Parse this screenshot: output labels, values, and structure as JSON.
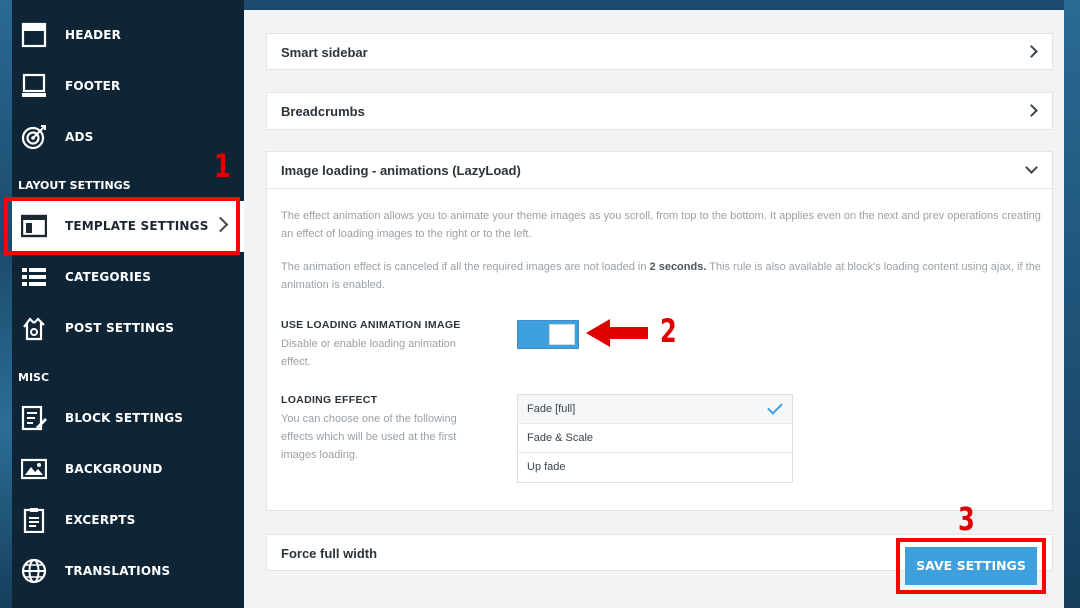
{
  "sidebar": {
    "items_top": [
      {
        "label": "HEADER",
        "icon": "header-icon"
      },
      {
        "label": "FOOTER",
        "icon": "footer-icon"
      },
      {
        "label": "ADS",
        "icon": "target-icon"
      }
    ],
    "layout_section": "LAYOUT SETTINGS",
    "items_layout": [
      {
        "label": "TEMPLATE SETTINGS",
        "icon": "template-icon",
        "active": true
      },
      {
        "label": "CATEGORIES",
        "icon": "list-icon"
      },
      {
        "label": "POST SETTINGS",
        "icon": "post-settings-icon"
      }
    ],
    "misc_section": "MISC",
    "items_misc": [
      {
        "label": "BLOCK SETTINGS",
        "icon": "block-settings-icon"
      },
      {
        "label": "BACKGROUND",
        "icon": "image-icon"
      },
      {
        "label": "EXCERPTS",
        "icon": "document-icon"
      },
      {
        "label": "TRANSLATIONS",
        "icon": "globe-icon"
      }
    ]
  },
  "panels": {
    "smart_sidebar": "Smart sidebar",
    "breadcrumbs": "Breadcrumbs",
    "image_loading": "Image loading - animations (LazyLoad)",
    "force_full_width": "Force full width"
  },
  "image_loading": {
    "desc1": "The effect animation allows you to animate your theme images as you scroll, from top to the bottom. It applies even on the next and prev operations creating an effect of loading images to the right or to the left.",
    "desc2_before": "The animation effect is canceled if all the required images are not loaded in ",
    "desc2_bold": "2 seconds.",
    "desc2_after": " This rule is also available at block's loading content using ajax, if the animation is enabled.",
    "toggle_title": "USE LOADING ANIMATION IMAGE",
    "toggle_desc": "Disable or enable loading animation effect.",
    "toggle_on": true,
    "effect_title": "LOADING EFFECT",
    "effect_desc": "You can choose one of the following effects which will be used at the first images loading.",
    "effect_options": [
      "Fade [full]",
      "Fade & Scale",
      "Up fade"
    ],
    "effect_selected": "Fade [full]"
  },
  "save_button": "SAVE SETTINGS",
  "annotations": {
    "n1": "1",
    "n2": "2",
    "n3": "3",
    "color": "#ff0000"
  },
  "colors": {
    "accent": "#3fa0de",
    "sidebar": "#0f2536"
  }
}
